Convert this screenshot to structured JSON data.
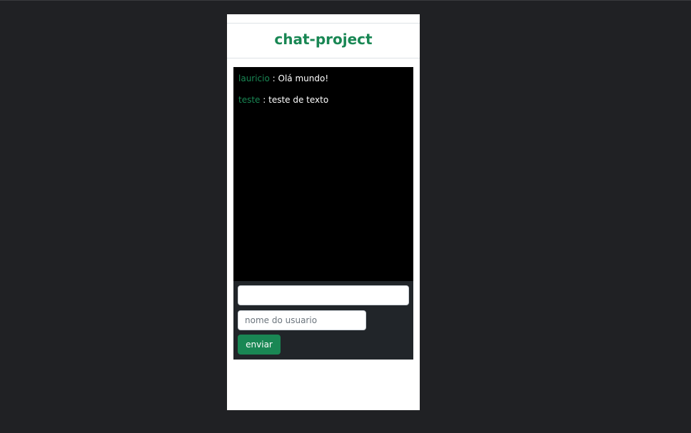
{
  "header": {
    "title": "chat-project"
  },
  "chat": {
    "messages": [
      {
        "user": "lauricio",
        "separator": " : ",
        "text": "Olá mundo!"
      },
      {
        "user": "teste",
        "separator": " : ",
        "text": "teste de texto"
      }
    ]
  },
  "form": {
    "message_value": "",
    "username_placeholder": "nome do usuario",
    "send_label": "enviar"
  },
  "colors": {
    "page_background": "#202124",
    "card_background": "#ffffff",
    "accent_green": "#198754",
    "chat_background": "#000000",
    "input_area_background": "#212529"
  }
}
